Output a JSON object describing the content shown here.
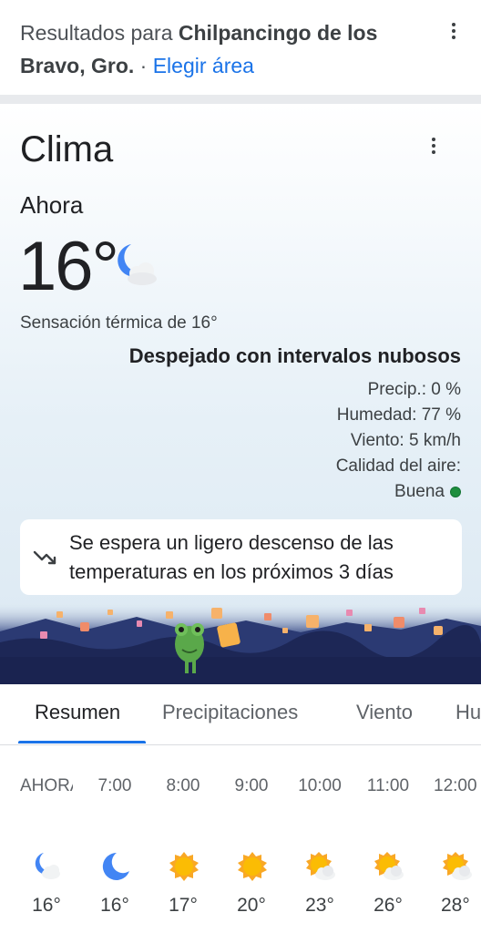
{
  "results_bar": {
    "prefix": "Resultados para",
    "location": "Chilpancingo de los Bravo, Gro.",
    "separator": "·",
    "change_area": "Elegir área",
    "menu_icon": "more-vert-icon"
  },
  "weather": {
    "title": "Clima",
    "menu_icon": "more-vert-icon",
    "now_label": "Ahora",
    "temperature": "16°",
    "condition_icon": "moon-cloud-icon",
    "feels_like": "Sensación térmica de 16°",
    "condition": "Despejado con intervalos nubosos",
    "precip": "Precip.: 0 %",
    "humidity": "Humedad: 77 %",
    "wind": "Viento: 5 km/h",
    "air_quality_label": "Calidad del aire:",
    "air_quality_value": "Buena",
    "air_quality_color": "#1e8e3e",
    "trend_icon": "trending-down-icon",
    "trend_text": "Se espera un ligero descenso de las temperaturas en los próximos 3 días"
  },
  "tabs": [
    {
      "label": "Resumen",
      "active": true
    },
    {
      "label": "Precipitaciones",
      "active": false
    },
    {
      "label": "Viento",
      "active": false
    },
    {
      "label": "Hu",
      "active": false
    }
  ],
  "hourly": [
    {
      "time": "AHORA",
      "icon": "moon-cloud-icon",
      "temp": "16°"
    },
    {
      "time": "7:00",
      "icon": "moon-icon",
      "temp": "16°"
    },
    {
      "time": "8:00",
      "icon": "sun-icon",
      "temp": "17°"
    },
    {
      "time": "9:00",
      "icon": "sun-icon",
      "temp": "20°"
    },
    {
      "time": "10:00",
      "icon": "sun-cloud-icon",
      "temp": "23°"
    },
    {
      "time": "11:00",
      "icon": "sun-cloud-icon",
      "temp": "26°"
    },
    {
      "time": "12:00",
      "icon": "sun-cloud-icon",
      "temp": "28°"
    }
  ],
  "colors": {
    "accent": "#1a73e8",
    "sun": "#f9a825",
    "moon": "#4285f4"
  }
}
